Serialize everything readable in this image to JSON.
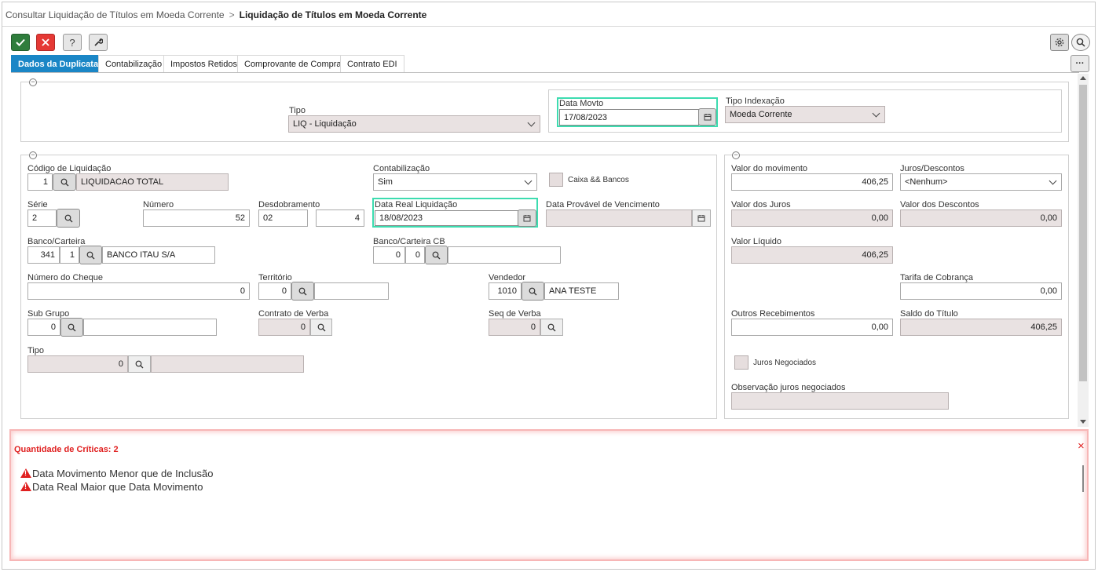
{
  "breadcrumb": {
    "parent": "Consultar Liquidação de Títulos em Moeda Corrente",
    "separator": ">",
    "current": "Liquidação de Títulos em Moeda Corrente"
  },
  "tabs": [
    {
      "label": "Dados da Duplicata",
      "active": true
    },
    {
      "label": "Contabilização"
    },
    {
      "label": "Impostos Retidos"
    },
    {
      "label": "Comprovante de Compra"
    },
    {
      "label": "Contrato EDI"
    }
  ],
  "more_label": "···",
  "top_panel": {
    "tipo": {
      "label": "Tipo",
      "value": "LIQ - Liquidação"
    },
    "data_movto": {
      "label": "Data Movto",
      "value": "17/08/2023"
    },
    "tipo_indexacao": {
      "label": "Tipo Indexação",
      "value": "Moeda Corrente"
    }
  },
  "main": {
    "codigo_liquidacao": {
      "label": "Código de Liquidação",
      "code": "1",
      "desc": "LIQUIDACAO TOTAL"
    },
    "contabilizacao": {
      "label": "Contabilização",
      "value": "Sim"
    },
    "caixa_bancos": {
      "label": "Caixa && Bancos"
    },
    "serie": {
      "label": "Série",
      "value": "2"
    },
    "numero": {
      "label": "Número",
      "value": "52"
    },
    "desdobramento": {
      "label": "Desdobramento",
      "value1": "02",
      "value2": "4"
    },
    "data_real": {
      "label": "Data Real Liquidação",
      "value": "18/08/2023"
    },
    "data_provavel": {
      "label": "Data Provável de Vencimento",
      "value": ""
    },
    "banco_carteira": {
      "label": "Banco/Carteira",
      "banco": "341",
      "carteira": "1",
      "desc": "BANCO ITAU S/A"
    },
    "banco_carteira_cb": {
      "label": "Banco/Carteira CB",
      "banco": "0",
      "carteira": "0",
      "desc": ""
    },
    "numero_cheque": {
      "label": "Número do Cheque",
      "value": "0"
    },
    "territorio": {
      "label": "Território",
      "value": "0"
    },
    "vendedor": {
      "label": "Vendedor",
      "code": "1010",
      "desc": "ANA TESTE"
    },
    "sub_grupo": {
      "label": "Sub Grupo",
      "value": "0"
    },
    "contrato_verba": {
      "label": "Contrato de Verba",
      "value": "0"
    },
    "seq_verba": {
      "label": "Seq de Verba",
      "value": "0"
    },
    "tipo2": {
      "label": "Tipo",
      "value": "0"
    }
  },
  "values": {
    "valor_movimento": {
      "label": "Valor do movimento",
      "value": "406,25"
    },
    "juros_descontos": {
      "label": "Juros/Descontos",
      "value": "<Nenhum>"
    },
    "valor_juros": {
      "label": "Valor dos Juros",
      "value": "0,00"
    },
    "valor_descontos": {
      "label": "Valor dos Descontos",
      "value": "0,00"
    },
    "valor_liquido": {
      "label": "Valor Líquido",
      "value": "406,25"
    },
    "tarifa_cobranca": {
      "label": "Tarifa de Cobrança",
      "value": "0,00"
    },
    "outros_recebimentos": {
      "label": "Outros Recebimentos",
      "value": "0,00"
    },
    "saldo_titulo": {
      "label": "Saldo do Título",
      "value": "406,25"
    },
    "juros_negociados": {
      "label": "Juros Negociados"
    },
    "observacao": {
      "label": "Observação juros negociados",
      "value": ""
    }
  },
  "errors": {
    "title": "Quantidade de Críticas: 2",
    "close": "×",
    "items": [
      "Data Movimento Menor que de Inclusão",
      "Data Real Maior que Data Movimento"
    ]
  },
  "colors": {
    "tab_active": "#1a86c6",
    "highlight": "#3ddcb0",
    "error": "#e02020",
    "confirm": "#2f7d3c",
    "cancel": "#e53935"
  }
}
